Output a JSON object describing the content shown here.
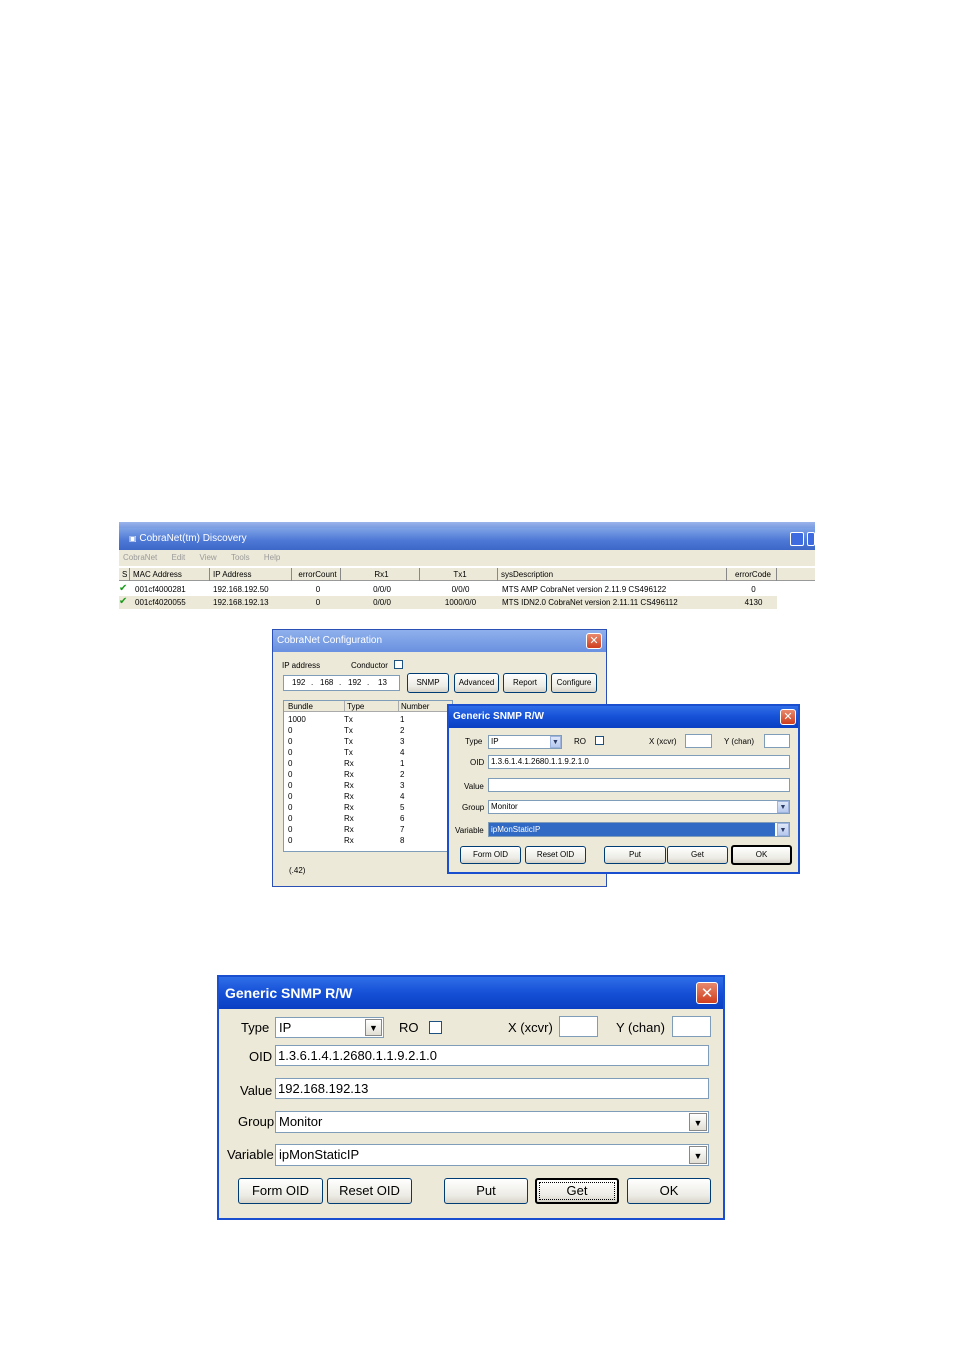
{
  "discovery": {
    "title": "CobraNet(tm) Discovery",
    "app_icon": "app-icon",
    "menu": [
      "CobraNet",
      "Edit",
      "View",
      "Tools",
      "Help"
    ],
    "columns": [
      "S",
      "MAC Address",
      "IP Address",
      "errorCount",
      "Rx1",
      "Tx1",
      "sysDescription",
      "errorCode"
    ],
    "rows": [
      {
        "status": "check-icon",
        "mac": "001cf4000281",
        "ip": "192.168.192.50",
        "errorCount": "0",
        "rx1": "0/0/0",
        "tx1": "0/0/0",
        "sysDescription": "MTS AMP CobraNet version 2.11.9 CS496122",
        "errorCode": "0"
      },
      {
        "status": "check-icon",
        "mac": "001cf4020055",
        "ip": "192.168.192.13",
        "errorCount": "0",
        "rx1": "0/0/0",
        "tx1": "1000/0/0",
        "sysDescription": "MTS IDN2.0 CobraNet version 2.11.11 CS496112",
        "errorCode": "4130"
      }
    ]
  },
  "config": {
    "title": "CobraNet Configuration",
    "ip_label": "IP address",
    "conductor_label": "Conductor",
    "ip_octets": [
      "192",
      "168",
      "192",
      "13"
    ],
    "buttons": [
      "SNMP",
      "Advanced",
      "Report",
      "Configure"
    ],
    "columns": [
      "Bundle",
      "Type",
      "Number"
    ],
    "rows": [
      [
        "1000",
        "Tx",
        "1"
      ],
      [
        "0",
        "Tx",
        "2"
      ],
      [
        "0",
        "Tx",
        "3"
      ],
      [
        "0",
        "Tx",
        "4"
      ],
      [
        "0",
        "Rx",
        "1"
      ],
      [
        "0",
        "Rx",
        "2"
      ],
      [
        "0",
        "Rx",
        "3"
      ],
      [
        "0",
        "Rx",
        "4"
      ],
      [
        "0",
        "Rx",
        "5"
      ],
      [
        "0",
        "Rx",
        "6"
      ],
      [
        "0",
        "Rx",
        "7"
      ],
      [
        "0",
        "Rx",
        "8"
      ]
    ],
    "status": "(.42)"
  },
  "snmp_small": {
    "title": "Generic SNMP R/W",
    "type_label": "Type",
    "type_value": "IP",
    "ro_label": "RO",
    "x_label": "X (xcvr)",
    "y_label": "Y (chan)",
    "oid_label": "OID",
    "oid_value": "1.3.6.1.4.1.2680.1.1.9.2.1.0",
    "value_label": "Value",
    "value_value": "",
    "group_label": "Group",
    "group_value": "Monitor",
    "variable_label": "Variable",
    "variable_value": "ipMonStaticIP",
    "buttons": {
      "form_oid": "Form OID",
      "reset_oid": "Reset OID",
      "put": "Put",
      "get": "Get",
      "ok": "OK"
    }
  },
  "snmp_large": {
    "title": "Generic SNMP R/W",
    "type_label": "Type",
    "type_value": "IP",
    "ro_label": "RO",
    "x_label": "X (xcvr)",
    "y_label": "Y (chan)",
    "oid_label": "OID",
    "oid_value": "1.3.6.1.4.1.2680.1.1.9.2.1.0",
    "value_label": "Value",
    "value_value": "192.168.192.13",
    "group_label": "Group",
    "group_value": "Monitor",
    "variable_label": "Variable",
    "variable_value": "ipMonStaticIP",
    "buttons": {
      "form_oid": "Form OID",
      "reset_oid": "Reset OID",
      "put": "Put",
      "get": "Get",
      "ok": "OK"
    }
  }
}
